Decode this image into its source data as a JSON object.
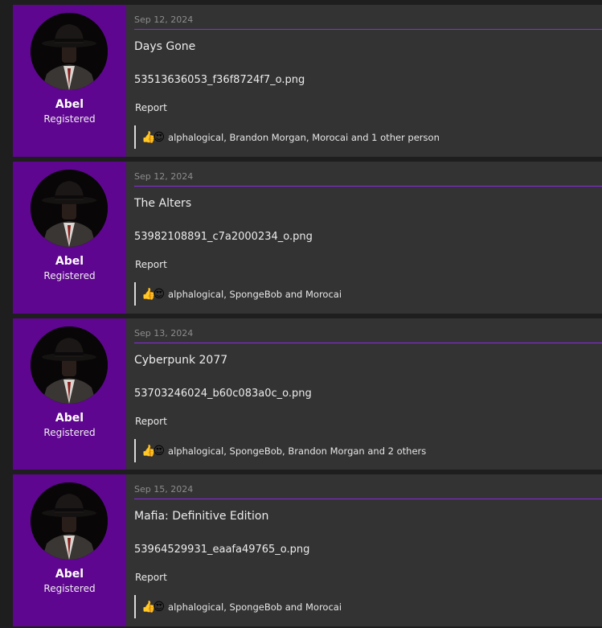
{
  "posts": [
    {
      "user": {
        "name": "Abel",
        "title": "Registered"
      },
      "date": "Sep 12, 2024",
      "title": "Days Gone",
      "attachment": "53513636053_f36f8724f7_o.png",
      "report_label": "Report",
      "reaction_icons": [
        "thumbs-up-icon",
        "heart-eyes-icon"
      ],
      "reactors": "alphalogical, Brandon Morgan, Morocai and 1 other person"
    },
    {
      "user": {
        "name": "Abel",
        "title": "Registered"
      },
      "date": "Sep 12, 2024",
      "title": "The Alters",
      "attachment": "53982108891_c7a2000234_o.png",
      "report_label": "Report",
      "reaction_icons": [
        "thumbs-up-icon",
        "heart-eyes-icon"
      ],
      "reactors": "alphalogical, SpongeBob and Morocai"
    },
    {
      "user": {
        "name": "Abel",
        "title": "Registered"
      },
      "date": "Sep 13, 2024",
      "title": "Cyberpunk 2077",
      "attachment": "53703246024_b60c083a0c_o.png",
      "report_label": "Report",
      "reaction_icons": [
        "thumbs-up-icon",
        "heart-eyes-icon"
      ],
      "reactors": "alphalogical, SpongeBob, Brandon Morgan and 2 others"
    },
    {
      "user": {
        "name": "Abel",
        "title": "Registered"
      },
      "date": "Sep 15, 2024",
      "title": "Mafia: Definitive Edition",
      "attachment": "53964529931_eaafa49765_o.png",
      "report_label": "Report",
      "reaction_icons": [
        "thumbs-up-icon",
        "heart-eyes-icon"
      ],
      "reactors": "alphalogical, SpongeBob and Morocai"
    }
  ],
  "colors": {
    "page_bg": "#1e1e1e",
    "post_bg": "#333333",
    "user_cell_bg": "#5f0690",
    "divider": "#8a2be2"
  }
}
